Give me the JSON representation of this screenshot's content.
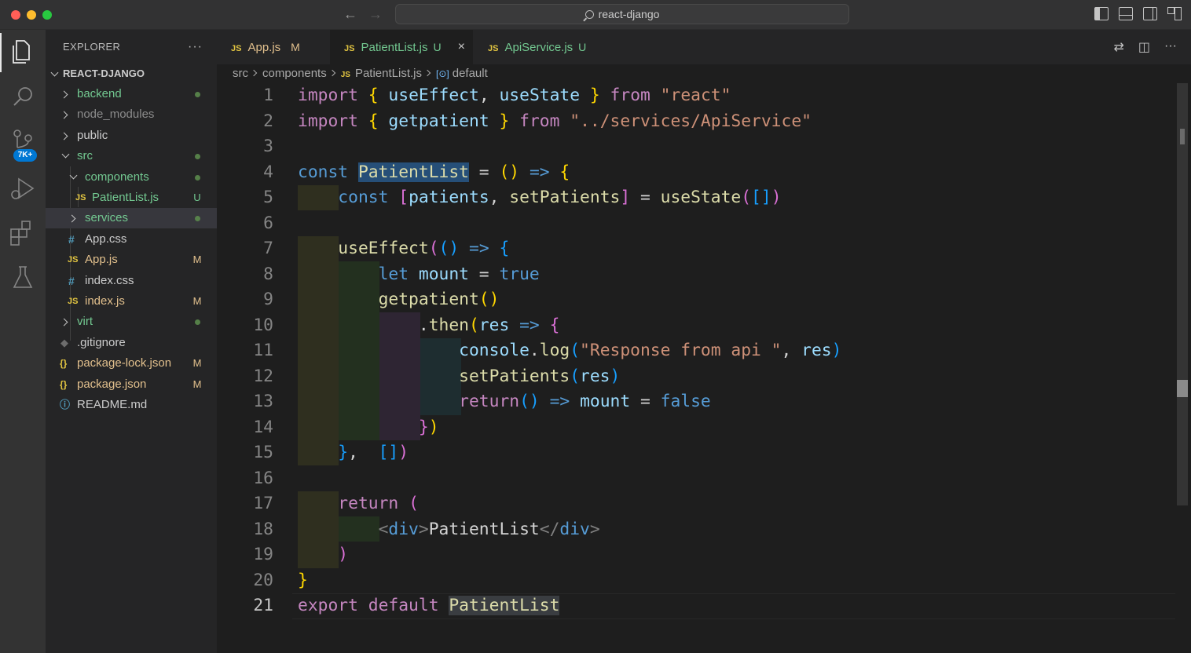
{
  "window": {
    "title": "react-django"
  },
  "explorer": {
    "header": "EXPLORER",
    "more": "···",
    "root": "REACT-DJANGO",
    "items": [
      {
        "label": "backend",
        "kind": "folder",
        "expanded": false,
        "status": "dot",
        "color": "#73c991"
      },
      {
        "label": "node_modules",
        "kind": "folder",
        "expanded": false,
        "status": "",
        "color": "#8c8c8c"
      },
      {
        "label": "public",
        "kind": "folder",
        "expanded": false,
        "status": "",
        "color": "#cccccc"
      },
      {
        "label": "src",
        "kind": "folder",
        "expanded": true,
        "status": "dot",
        "color": "#73c991"
      },
      {
        "label": "components",
        "kind": "folder",
        "expanded": true,
        "status": "dot",
        "color": "#73c991"
      },
      {
        "label": "PatientList.js",
        "kind": "js",
        "status": "U",
        "color": "#73c991"
      },
      {
        "label": "services",
        "kind": "folder",
        "expanded": false,
        "status": "dot",
        "color": "#73c991",
        "selected": true
      },
      {
        "label": "App.css",
        "kind": "css",
        "status": "",
        "color": "#cccccc"
      },
      {
        "label": "App.js",
        "kind": "js",
        "status": "M",
        "color": "#e2c08d"
      },
      {
        "label": "index.css",
        "kind": "css",
        "status": "",
        "color": "#cccccc"
      },
      {
        "label": "index.js",
        "kind": "js",
        "status": "M",
        "color": "#e2c08d"
      },
      {
        "label": "virt",
        "kind": "folder",
        "expanded": false,
        "status": "dot",
        "color": "#73c991"
      },
      {
        "label": ".gitignore",
        "kind": "git",
        "status": "",
        "color": "#cccccc"
      },
      {
        "label": "package-lock.json",
        "kind": "json",
        "status": "M",
        "color": "#e2c08d"
      },
      {
        "label": "package.json",
        "kind": "json",
        "status": "M",
        "color": "#e2c08d"
      },
      {
        "label": "README.md",
        "kind": "info",
        "status": "",
        "color": "#cccccc"
      }
    ]
  },
  "activity": {
    "scm_badge": "7K+"
  },
  "tabs": [
    {
      "label": "App.js",
      "status": "M",
      "color": "#e2c08d"
    },
    {
      "label": "PatientList.js",
      "status": "U",
      "color": "#73c991",
      "active": true,
      "close": "×"
    },
    {
      "label": "ApiService.js",
      "status": "U",
      "color": "#73c991"
    }
  ],
  "breadcrumbs": {
    "part1": "src",
    "part2": "components",
    "file": "PatientList.js",
    "symbol": "default"
  },
  "code": {
    "line_numbers": [
      "1",
      "2",
      "3",
      "4",
      "5",
      "6",
      "7",
      "8",
      "9",
      "10",
      "11",
      "12",
      "13",
      "14",
      "15",
      "16",
      "17",
      "18",
      "19",
      "20",
      "21"
    ],
    "current_line": 21
  }
}
